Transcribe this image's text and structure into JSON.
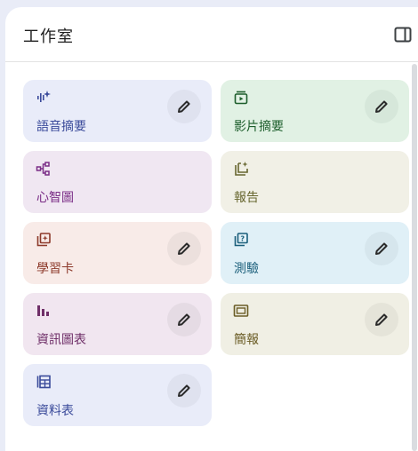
{
  "panel": {
    "title": "工作室"
  },
  "cards": [
    {
      "label": "語音摘要",
      "icon": "audio-waveform-sparkle-icon"
    },
    {
      "label": "影片摘要",
      "icon": "video-player-icon"
    },
    {
      "label": "心智圖",
      "icon": "mind-map-icon"
    },
    {
      "label": "報告",
      "icon": "report-sparkle-icon"
    },
    {
      "label": "學習卡",
      "icon": "flashcards-icon"
    },
    {
      "label": "測驗",
      "icon": "quiz-icon"
    },
    {
      "label": "資訊圖表",
      "icon": "infographic-bars-icon"
    },
    {
      "label": "簡報",
      "icon": "slides-icon"
    },
    {
      "label": "資料表",
      "icon": "data-table-icon"
    }
  ],
  "colors": {
    "audio": "#3a4a9a",
    "video": "#1d5e2c",
    "mind": "#7a2d86",
    "report": "#686730",
    "flash": "#8d3a2b",
    "quiz": "#1b5f7b",
    "info": "#6f2f68",
    "slides": "#6b5d26"
  }
}
